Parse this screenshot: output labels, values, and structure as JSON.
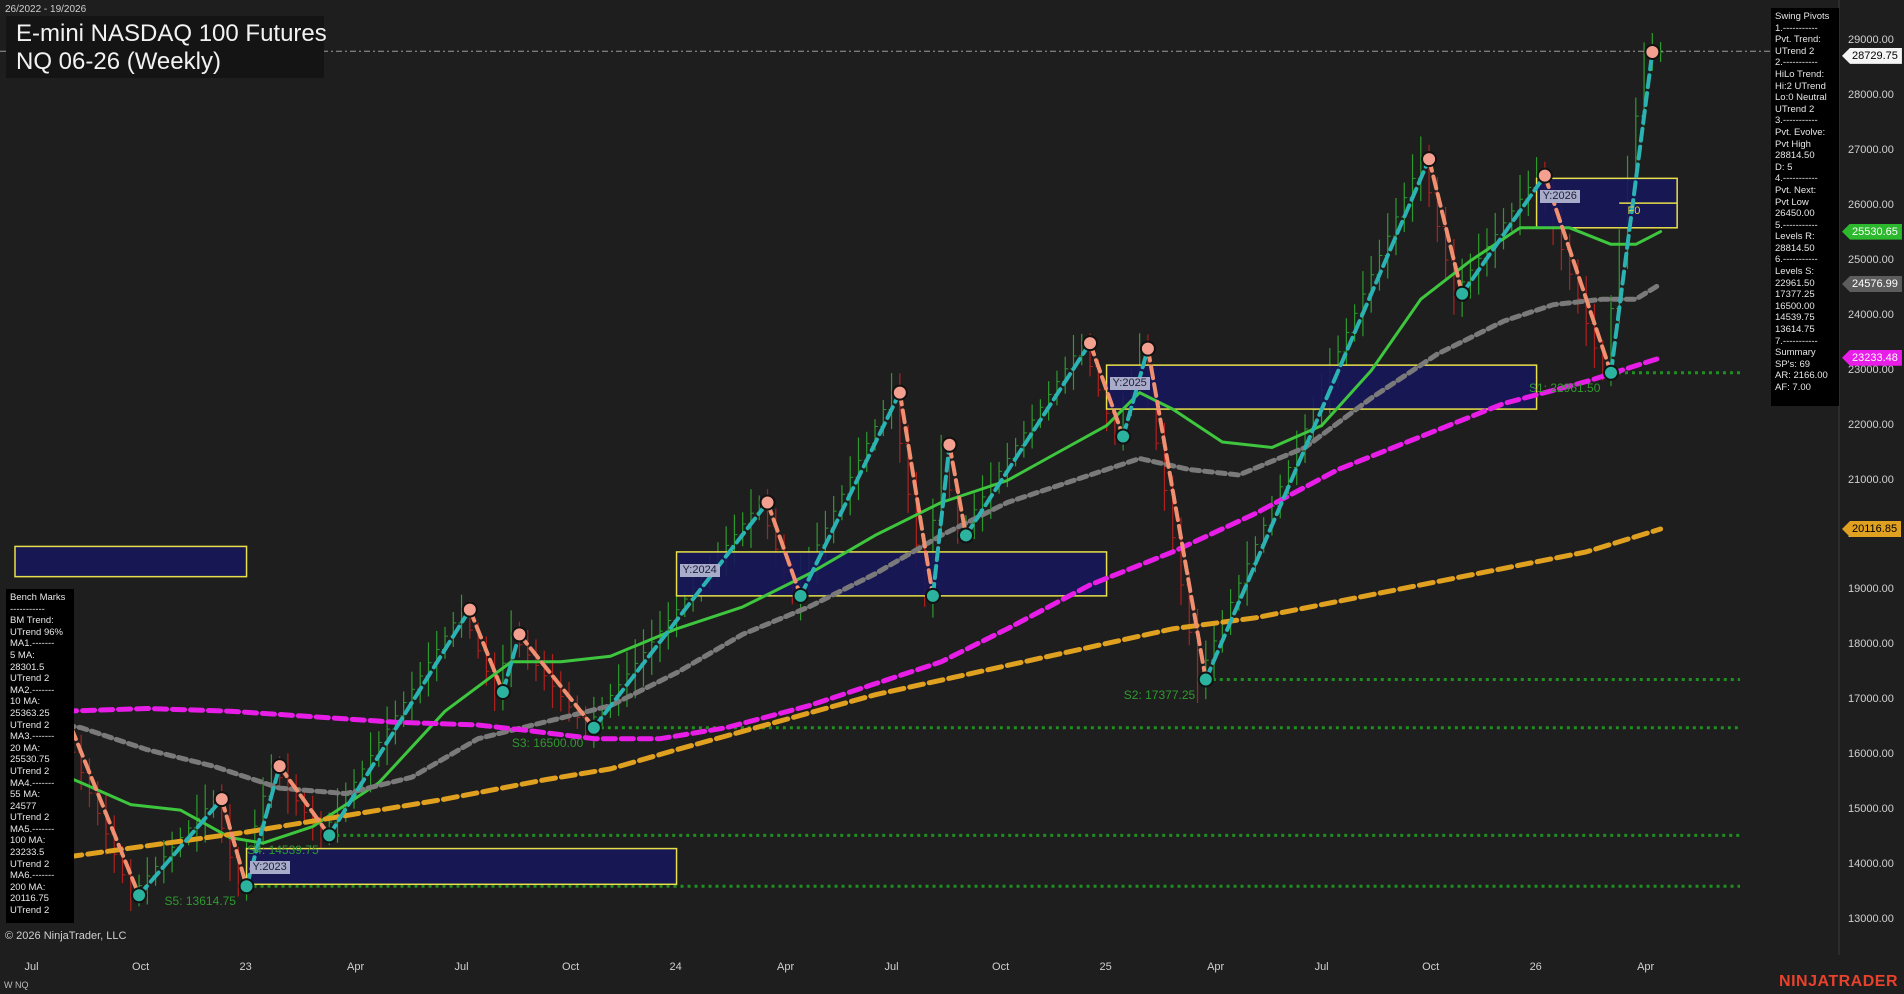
{
  "header": {
    "date_range": "26/2022 - 19/2026",
    "title_line1": "E-mini NASDAQ 100 Futures",
    "title_line2": "NQ 06-26 (Weekly)"
  },
  "footer": {
    "copyright": "© 2026 NinjaTrader, LLC",
    "instrument_tag": "W NQ",
    "brand": "NINJATRADER"
  },
  "swing_panel": "Swing Pivots\n1.-----------\nPvt. Trend:\nUTrend 2\n2.-----------\nHiLo Trend:\nHi:2 UTrend\nLo:0 Neutral\nUTrend 2\n3.-----------\nPvt. Evolve:\nPvt High\n28814.50\nD: 5\n4.-----------\nPvt. Next:\nPvt Low\n26450.00\n5.-----------\nLevels R:\n28814.50\n6.-----------\nLevels S:\n22961.50\n17377.25\n16500.00\n14539.75\n13614.75\n7.-----------\nSummary\nSP's: 69\nAR: 2166.00\nAF: 7.00",
  "bench_panel": "Bench Marks\n-----------\nBM Trend:\nUTrend 96%\nMA1.-------\n5 MA:\n28301.5\nUTrend 2\nMA2.-------\n10 MA:\n25363.25\nUTrend 2\nMA3.-------\n20 MA:\n25530.75\nUTrend 2\nMA4.-------\n55 MA:\n24577\nUTrend 2\nMA5.-------\n100 MA:\n23233.5\nUTrend 2\nMA6.-------\n200 MA:\n20116.75\nUTrend 2",
  "colors": {
    "background": "#1e1e1e",
    "ma_green": "#3ec63e",
    "ma_gray": "#7a7a7a",
    "ma_magenta": "#e81ee8",
    "ma_orange": "#e0a020",
    "swing_up": "#2bb3b3",
    "swing_down": "#f09070",
    "bar_up": "#2e9a2e",
    "bar_down": "#b0201e",
    "year_box": "#16165a",
    "year_border": "#e8e04a",
    "support": "#1f8f1f"
  },
  "chart_data": {
    "type": "line",
    "title": "E-mini NASDAQ 100 Futures NQ 06-26 (Weekly)",
    "y_axis": {
      "ticks": [
        13000,
        14000,
        15000,
        16000,
        17000,
        18000,
        19000,
        20000,
        21000,
        22000,
        23000,
        24000,
        25000,
        26000,
        27000,
        28000,
        29000
      ],
      "range": [
        12600,
        29800
      ],
      "position": "right"
    },
    "x_axis": {
      "labels": [
        "Jul",
        "Oct",
        "23",
        "Apr",
        "Jul",
        "Oct",
        "24",
        "Apr",
        "Jul",
        "Oct",
        "25",
        "Apr",
        "Jul",
        "Oct",
        "26",
        "Apr"
      ],
      "label_week": [
        2,
        15,
        28,
        41,
        54,
        67,
        80,
        93,
        106,
        119,
        132,
        145,
        158,
        171,
        184,
        197
      ],
      "range_weeks": [
        0,
        219
      ]
    },
    "price_tags": [
      {
        "label": "28729.75",
        "value": 28729.75,
        "bg": "#f5f5f5",
        "fg": "#000000"
      },
      {
        "label": "25530.65",
        "value": 25530.65,
        "bg": "#2db92d",
        "fg": "#ffffff"
      },
      {
        "label": "24576.99",
        "value": 24576.99,
        "bg": "#5c5c5c",
        "fg": "#ffffff"
      },
      {
        "label": "23233.48",
        "value": 23233.48,
        "bg": "#e81ee8",
        "fg": "#ffffff"
      },
      {
        "label": "20116.85",
        "value": 20116.85,
        "bg": "#e0a020",
        "fg": "#000000"
      }
    ],
    "swing_pivots": [
      {
        "week": 6,
        "value": 16800,
        "kind": "high"
      },
      {
        "week": 15,
        "value": 13450,
        "kind": "low"
      },
      {
        "week": 25,
        "value": 15200,
        "kind": "high"
      },
      {
        "week": 28,
        "value": 13614.75,
        "kind": "low"
      },
      {
        "week": 32,
        "value": 15800,
        "kind": "high"
      },
      {
        "week": 38,
        "value": 14539.75,
        "kind": "low"
      },
      {
        "week": 55,
        "value": 18650,
        "kind": "high"
      },
      {
        "week": 59,
        "value": 17150,
        "kind": "low"
      },
      {
        "week": 61,
        "value": 18200,
        "kind": "high"
      },
      {
        "week": 70,
        "value": 16500,
        "kind": "low"
      },
      {
        "week": 91,
        "value": 20600,
        "kind": "high"
      },
      {
        "week": 95,
        "value": 18900,
        "kind": "low"
      },
      {
        "week": 107,
        "value": 22600,
        "kind": "high"
      },
      {
        "week": 111,
        "value": 18900,
        "kind": "low"
      },
      {
        "week": 113,
        "value": 21650,
        "kind": "high"
      },
      {
        "week": 115,
        "value": 20000,
        "kind": "low"
      },
      {
        "week": 130,
        "value": 23500,
        "kind": "high"
      },
      {
        "week": 134,
        "value": 21800,
        "kind": "low"
      },
      {
        "week": 137,
        "value": 23400,
        "kind": "high"
      },
      {
        "week": 144,
        "value": 17377.25,
        "kind": "low"
      },
      {
        "week": 171,
        "value": 26850,
        "kind": "high"
      },
      {
        "week": 175,
        "value": 24400,
        "kind": "low"
      },
      {
        "week": 185,
        "value": 26550,
        "kind": "high"
      },
      {
        "week": 193,
        "value": 22961.5,
        "kind": "low"
      },
      {
        "week": 198,
        "value": 28800,
        "kind": "high"
      }
    ],
    "moving_averages": [
      {
        "name": "20 MA",
        "color": "#3ec63e",
        "dash": "",
        "weeks": [
          0,
          8,
          14,
          20,
          26,
          30,
          36,
          44,
          52,
          60,
          66,
          72,
          80,
          88,
          96,
          104,
          112,
          120,
          126,
          132,
          136,
          140,
          146,
          152,
          158,
          164,
          170,
          176,
          182,
          188,
          193,
          196,
          199
        ],
        "values": [
          16000,
          15500,
          15100,
          15000,
          14500,
          14400,
          14700,
          15500,
          16800,
          17700,
          17700,
          17800,
          18300,
          18700,
          19300,
          20000,
          20600,
          21000,
          21500,
          22000,
          22600,
          22300,
          21700,
          21600,
          22000,
          23000,
          24300,
          25000,
          25600,
          25600,
          25300,
          25300,
          25530.65
        ]
      },
      {
        "name": "55 MA",
        "color": "#7a7a7a",
        "dash": "8 5",
        "weeks": [
          0,
          8,
          16,
          24,
          32,
          40,
          48,
          56,
          64,
          72,
          80,
          88,
          96,
          104,
          112,
          120,
          128,
          136,
          142,
          148,
          156,
          164,
          172,
          180,
          186,
          192,
          196,
          199
        ],
        "values": [
          16700,
          16500,
          16100,
          15800,
          15400,
          15300,
          15600,
          16300,
          16600,
          16900,
          17500,
          18200,
          18700,
          19300,
          20000,
          20600,
          21000,
          21400,
          21200,
          21100,
          21600,
          22500,
          23300,
          23900,
          24200,
          24300,
          24300,
          24576.99
        ]
      },
      {
        "name": "100 MA",
        "color": "#e81ee8",
        "dash": "12 6",
        "weeks": [
          6,
          16,
          26,
          36,
          46,
          56,
          62,
          70,
          78,
          86,
          96,
          104,
          112,
          120,
          130,
          140,
          150,
          160,
          170,
          180,
          190,
          199
        ],
        "values": [
          16800,
          16850,
          16800,
          16700,
          16600,
          16550,
          16450,
          16300,
          16300,
          16500,
          16900,
          17300,
          17700,
          18300,
          19100,
          19700,
          20400,
          21200,
          21800,
          22400,
          22800,
          23233.48
        ]
      },
      {
        "name": "200 MA",
        "color": "#e0a020",
        "dash": "14 6",
        "weeks": [
          4,
          16,
          28,
          40,
          52,
          64,
          72,
          80,
          92,
          104,
          116,
          128,
          140,
          150,
          160,
          170,
          180,
          190,
          199
        ],
        "values": [
          14100,
          14350,
          14600,
          14900,
          15200,
          15550,
          15750,
          16100,
          16600,
          17100,
          17500,
          17900,
          18300,
          18500,
          18800,
          19100,
          19400,
          19700,
          20116.85
        ]
      }
    ],
    "year_boxes": [
      {
        "label": "Y:2023",
        "week_start": 28,
        "week_end": 80,
        "high": 14300,
        "low": 13650
      },
      {
        "label": "Y:2024",
        "week_start": 80,
        "week_end": 132,
        "high": 19700,
        "low": 18900
      },
      {
        "label": "Y:2025",
        "week_start": 132,
        "week_end": 184,
        "high": 23100,
        "low": 22300
      },
      {
        "label": "Y:2026",
        "week_start": 184,
        "week_end": 201,
        "high": 26500,
        "low": 25600
      },
      {
        "label": "",
        "week_start": 0,
        "week_end": 28,
        "high": 19800,
        "low": 19250
      }
    ],
    "supports": [
      {
        "label": "S5: 13614.75",
        "value": 13614.75,
        "week_start": 28
      },
      {
        "label": "S4: 14539.75",
        "value": 14539.75,
        "week_start": 38
      },
      {
        "label": "S3: 16500.00",
        "value": 16500,
        "week_start": 70
      },
      {
        "label": "S2: 17377.25",
        "value": 17377.25,
        "week_start": 144
      },
      {
        "label": "S1: 22961.50",
        "value": 22961.5,
        "week_start": 193
      }
    ],
    "resistance": {
      "value": 28814.5
    },
    "f0_level": {
      "label": "F0",
      "value": 26050
    }
  }
}
